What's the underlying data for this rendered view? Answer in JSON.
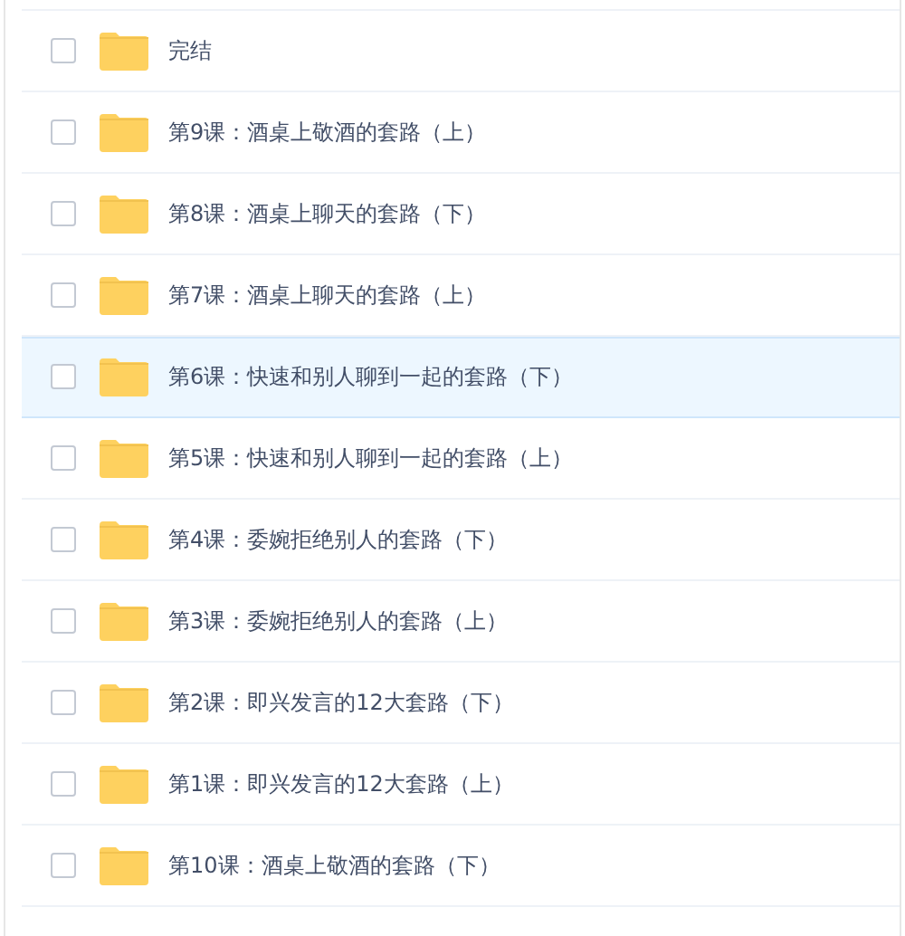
{
  "folders": [
    {
      "name": "完结",
      "checked": false,
      "highlighted": false
    },
    {
      "name": "第9课：酒桌上敬酒的套路（上）",
      "checked": false,
      "highlighted": false
    },
    {
      "name": "第8课：酒桌上聊天的套路（下）",
      "checked": false,
      "highlighted": false
    },
    {
      "name": "第7课：酒桌上聊天的套路（上）",
      "checked": false,
      "highlighted": false
    },
    {
      "name": "第6课：快速和别人聊到一起的套路（下）",
      "checked": false,
      "highlighted": true
    },
    {
      "name": "第5课：快速和别人聊到一起的套路（上）",
      "checked": false,
      "highlighted": false
    },
    {
      "name": "第4课：委婉拒绝别人的套路（下）",
      "checked": false,
      "highlighted": false
    },
    {
      "name": "第3课：委婉拒绝别人的套路（上）",
      "checked": false,
      "highlighted": false
    },
    {
      "name": "第2课：即兴发言的12大套路（下）",
      "checked": false,
      "highlighted": false
    },
    {
      "name": "第1课：即兴发言的12大套路（上）",
      "checked": false,
      "highlighted": false
    },
    {
      "name": "第10课：酒桌上敬酒的套路（下）",
      "checked": false,
      "highlighted": false
    }
  ]
}
